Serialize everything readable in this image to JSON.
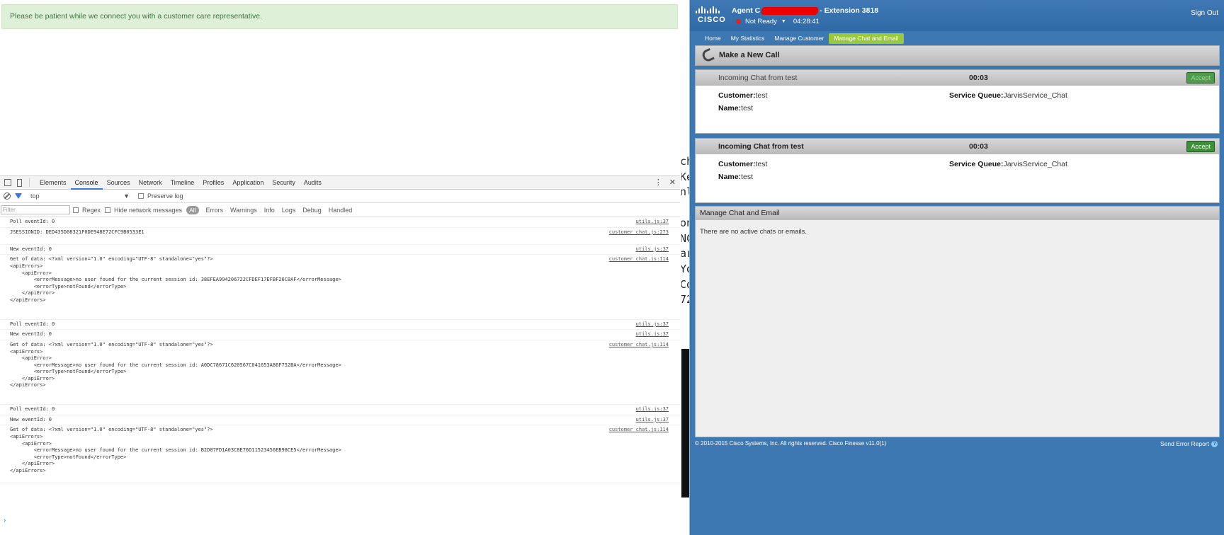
{
  "customer_page": {
    "banner": "Please be patient while we connect you with a customer care representative."
  },
  "devtools": {
    "tabs": [
      "Elements",
      "Console",
      "Sources",
      "Network",
      "Timeline",
      "Profiles",
      "Application",
      "Security",
      "Audits"
    ],
    "active_tab": "Console",
    "menu_glyph": "⋮",
    "close_glyph": "✕",
    "context": "top",
    "preserve_log": "Preserve log",
    "filter_placeholder": "Filter",
    "regex": "Regex",
    "hide_network": "Hide network messages",
    "levels": [
      "All",
      "Errors",
      "Warnings",
      "Info",
      "Logs",
      "Debug",
      "Handled"
    ],
    "messages": [
      {
        "text": "Poll eventId: 0",
        "src": "utils.js:37"
      },
      {
        "text": "JSESSIONID: DED435D08321F0DE948E72CFC9B0533E1\n\n",
        "src": "customer_chat.js:273"
      },
      {
        "text": "New eventId: 0",
        "src": "utils.js:37"
      },
      {
        "text": "Get of data: <?xml version=\"1.0\" encoding=\"UTF-8\" standalone=\"yes\"?>\n<apiErrors>\n    <apiError>\n        <errorMessage>no user found for the current session id: 38EFEA994206722CFDEF17EFBF26C8AF</errorMessage>\n        <errorType>notFound</errorType>\n    </apiError>\n</apiErrors>\n\n\n",
        "src": "customer_chat.js:114"
      },
      {
        "text": "Poll eventId: 0",
        "src": "utils.js:37"
      },
      {
        "text": "New eventId: 0",
        "src": "utils.js:37"
      },
      {
        "text": "Get of data: <?xml version=\"1.0\" encoding=\"UTF-8\" standalone=\"yes\"?>\n<apiErrors>\n    <apiError>\n        <errorMessage>no user found for the current session id: A0DC78671C620567C041653A86F752BA</errorMessage>\n        <errorType>notFound</errorType>\n    </apiError>\n</apiErrors>\n\n\n",
        "src": "customer_chat.js:114"
      },
      {
        "text": "Poll eventId: 0",
        "src": "utils.js:37"
      },
      {
        "text": "New eventId: 0",
        "src": "utils.js:37"
      },
      {
        "text": "Get of data: <?xml version=\"1.0\" encoding=\"UTF-8\" standalone=\"yes\"?>\n<apiErrors>\n    <apiError>\n        <errorMessage>no user found for the current session id: B2D87FD1A03C8E76D11523456EB98CE5</errorMessage>\n        <errorType>notFound</errorType>\n    </apiError>\n</apiErrors>\n\n",
        "src": "customer_chat.js:114"
      }
    ],
    "prompt": "›"
  },
  "strip_glyphs": [
    "ch",
    "Ke",
    "nl",
    "",
    "on",
    "NC",
    "ar",
    "Yo",
    "Co",
    "72"
  ],
  "finesse": {
    "logo": "CISCO",
    "agent_prefix": "Agent C",
    "agent_suffix": "- Extension 3818",
    "state": "Not Ready",
    "timer": "04:28:41",
    "sign_out": "Sign Out",
    "nav": [
      "Home",
      "My Statistics",
      "Manage Customer",
      "Manage Chat and Email"
    ],
    "active_nav": "Manage Chat and Email",
    "make_call": "Make a New Call",
    "chats": [
      {
        "title": "Incoming Chat from test",
        "time": "00:03",
        "accept": "Accept",
        "customer_label": "Customer:",
        "customer": "test",
        "queue_label": "Service Queue:",
        "queue": "JarvisService_Chat",
        "name_label": "Name:",
        "name": "test"
      },
      {
        "title": "Incoming Chat from test",
        "time": "00:03",
        "accept": "Accept",
        "customer_label": "Customer:",
        "customer": "test",
        "queue_label": "Service Queue:",
        "queue": "JarvisService_Chat",
        "name_label": "Name:",
        "name": "test"
      }
    ],
    "manage_title": "Manage Chat and Email",
    "manage_empty": "There are no active chats or emails.",
    "footer": "© 2010-2015 Cisco Systems, Inc. All rights reserved. Cisco Finesse v11.0(1)",
    "send_error": "Send Error Report",
    "help_glyph": "?"
  },
  "colors": {
    "finesse_bg": "#3e78b2",
    "nav_active": "#9ac93e",
    "accept_green": "#3f8f3a",
    "banner_green": "#dff0d8"
  }
}
